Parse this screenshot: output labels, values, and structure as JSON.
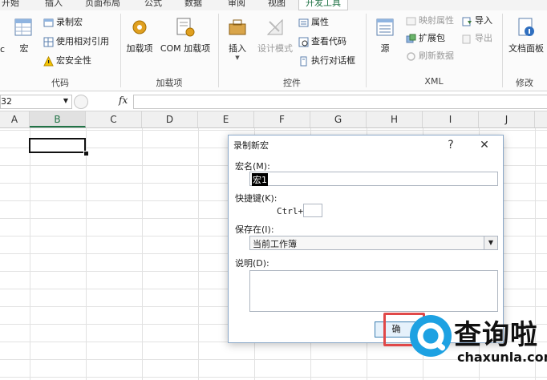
{
  "ribbon": {
    "tabs": [
      "开始",
      "插入",
      "页面布局",
      "公式",
      "数据",
      "审阅",
      "视图",
      "开发工具"
    ],
    "active_tab_index": 7,
    "groups": {
      "code": {
        "label": "代码",
        "vb_partial": "c",
        "macro_label": "宏",
        "record_macro": "录制宏",
        "relative_ref": "使用相对引用",
        "macro_security": "宏安全性"
      },
      "addins": {
        "label": "加载项",
        "addins_btn": "加载项",
        "com_addins_btn": "COM 加载项"
      },
      "controls": {
        "label": "控件",
        "insert_btn": "插入",
        "design_mode_btn": "设计模式",
        "properties": "属性",
        "view_code": "查看代码",
        "run_dialog": "执行对话框"
      },
      "xml": {
        "label": "XML",
        "source_btn": "源",
        "map_properties": "映射属性",
        "expansion_packs": "扩展包",
        "refresh_data": "刷新数据",
        "import": "导入",
        "export": "导出"
      },
      "modify": {
        "label": "修改",
        "doc_panel_btn": "文档面板"
      }
    }
  },
  "formula_bar": {
    "name_box": "32",
    "fx_label": "fx"
  },
  "grid": {
    "columns": [
      "A",
      "B",
      "C",
      "D",
      "E",
      "F",
      "G",
      "H",
      "I",
      "J"
    ],
    "selected_column": "B"
  },
  "dialog": {
    "title": "录制新宏",
    "help": "?",
    "close": "✕",
    "macro_name_label": "宏名(M):",
    "macro_name_value": "宏1",
    "shortcut_label": "快捷键(K):",
    "ctrl_prefix": "Ctrl+",
    "shortcut_value": "",
    "store_in_label": "保存在(I):",
    "store_in_value": "当前工作簿",
    "description_label": "说明(D):",
    "description_value": "",
    "ok_partial": "确"
  },
  "watermark": {
    "brand_cn": "查询啦",
    "brand_url": "chaxunla.com"
  }
}
